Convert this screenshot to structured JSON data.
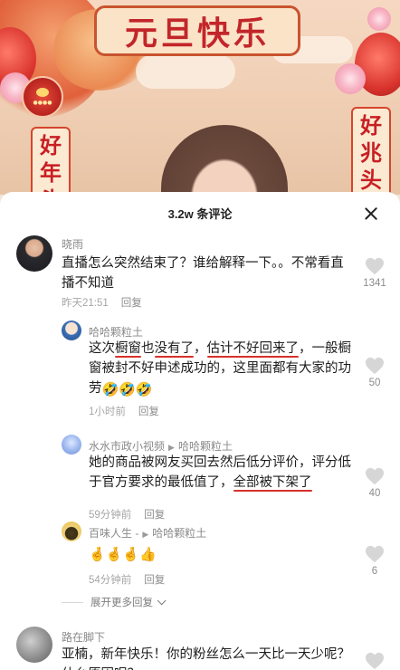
{
  "banner": {
    "title": "元旦快乐",
    "left_vertical": [
      "好",
      "年",
      "头"
    ],
    "right_vertical": [
      "好",
      "兆",
      "头"
    ]
  },
  "sheet": {
    "comment_count": "3.2w 条评论"
  },
  "comments": [
    {
      "user": "晓雨",
      "text": "直播怎么突然结束了？谁给解释一下。。不常看直播不知道",
      "time": "昨天21:51",
      "reply_label": "回复",
      "likes": "1341"
    },
    {
      "user": "哈哈颗粒土",
      "text_parts": [
        "这次",
        "橱窗",
        "也",
        "没有了",
        "，",
        "估计不好回来了",
        "，",
        "一般橱窗被封不好申述成功的",
        "，",
        "这里面都有大家的功劳"
      ],
      "emoji": "🤣🤣🤣",
      "time": "1小时前",
      "reply_label": "回复",
      "likes": "50"
    },
    {
      "user": "水水市政小视频",
      "reply_to": "哈哈颗粒土",
      "text_a": "她的商品被网友买回去然后低分评价，评分低于官方要求的最低值了，",
      "text_b": "全部被下架了",
      "time": "59分钟前",
      "reply_label": "回复",
      "likes": "40"
    },
    {
      "user": "百味人生 -",
      "reply_to": "哈哈颗粒土",
      "emoji": "🤞🤞🤞👍",
      "time": "54分钟前",
      "reply_label": "回复",
      "likes": "6"
    },
    {
      "user": "路在脚下",
      "text": "亚楠，新年快乐！你的粉丝怎么一天比一天少呢？什么原因呢？"
    }
  ],
  "expand_label": "展开更多回复",
  "colors": {
    "highlight": "#d8302a",
    "banner_red": "#c2262a"
  }
}
